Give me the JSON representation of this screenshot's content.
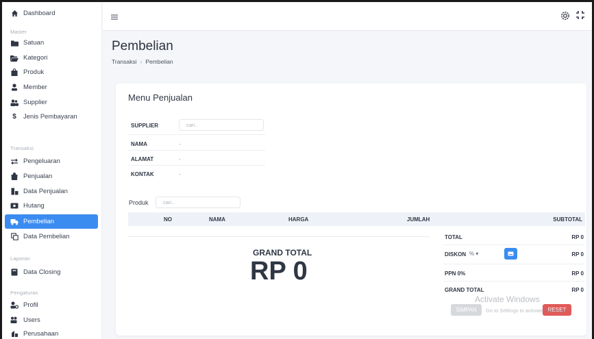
{
  "sidebar": {
    "dashboard": "Dashboard",
    "section_master": "Master",
    "satuan": "Satuan",
    "kategori": "Kategori",
    "produk": "Produk",
    "member": "Member",
    "supplier": "Supplier",
    "jenis_pembayaran": "Jenis Pembayaran",
    "section_transaksi": "Transaksi",
    "pengeluaran": "Pengeluaran",
    "penjualan": "Penjualan",
    "data_penjualan": "Data Penjualan",
    "hutang": "Hutang",
    "pembelian": "Pembelian",
    "data_pembelian": "Data Pembelian",
    "section_laporan": "Laporan",
    "data_closing": "Data Closing",
    "section_pengaturan": "Pengaturan",
    "profil": "Profil",
    "users": "Users",
    "perusahaan": "Perusahaan",
    "active_color": "#3b8cf0"
  },
  "page": {
    "title": "Pembelian",
    "breadcrumb": [
      "Transaksi",
      "Pembelian"
    ]
  },
  "form": {
    "card_title": "Menu Penjualan",
    "supplier_label": "SUPPLIER",
    "supplier_placeholder": "cari..",
    "nama_label": "NAMA",
    "nama_value": "-",
    "alamat_label": "ALAMAT",
    "alamat_value": "-",
    "kontak_label": "KONTAK",
    "kontak_value": "-",
    "produk_label": "Produk",
    "produk_placeholder": "cari.."
  },
  "table": {
    "columns": [
      "NO",
      "NAMA",
      "HARGA",
      "JUMLAH",
      "SUBTOTAL"
    ]
  },
  "grand_total": {
    "label": "GRAND TOTAL",
    "value": "RP 0"
  },
  "summary": {
    "total_label": "TOTAL",
    "total_value": "RP 0",
    "diskon_label": "DISKON",
    "diskon_unit": "% ▾",
    "diskon_value": "RP 0",
    "ppn_label": "PPN 0%",
    "ppn_value": "RP 0",
    "grand_label": "GRAND TOTAL",
    "grand_value": "RP 0",
    "simpan": "SIMPAN",
    "reset": "RESET"
  },
  "watermark": {
    "title": "Activate Windows",
    "subtitle": "Go to Settings to activate Windows."
  }
}
